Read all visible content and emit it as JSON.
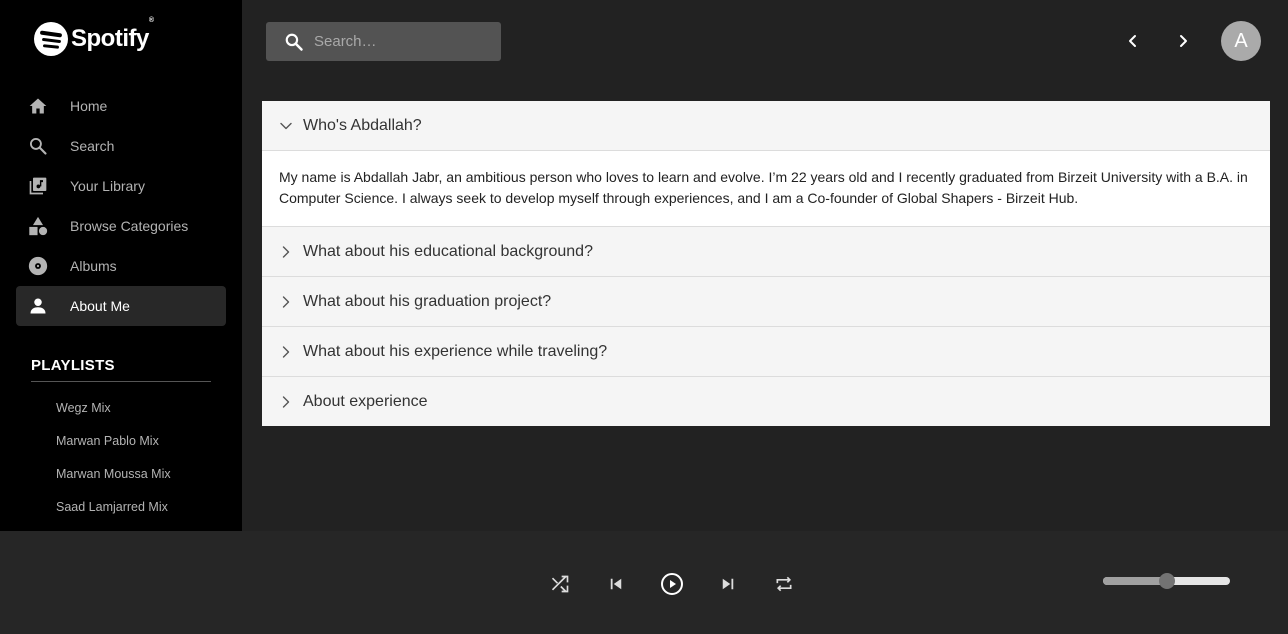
{
  "brand": {
    "name": "Spotify",
    "mark": "®"
  },
  "sidebar": {
    "items": [
      {
        "label": "Home",
        "icon": "home-icon"
      },
      {
        "label": "Search",
        "icon": "search-icon"
      },
      {
        "label": "Your Library",
        "icon": "library-icon"
      },
      {
        "label": "Browse Categories",
        "icon": "categories-icon"
      },
      {
        "label": "Albums",
        "icon": "album-icon"
      },
      {
        "label": "About Me",
        "icon": "person-icon",
        "active": true
      }
    ],
    "playlists_title": "PLAYLISTS",
    "playlists": [
      "Wegz Mix",
      "Marwan Pablo Mix",
      "Marwan Moussa Mix",
      "Saad Lamjarred Mix"
    ]
  },
  "search": {
    "placeholder": "Search…"
  },
  "header": {
    "avatar_letter": "A"
  },
  "accordion": [
    {
      "title": "Who's Abdallah?",
      "expanded": true,
      "body": "My name is Abdallah Jabr, an ambitious person who loves to learn and evolve. I’m 22 years old and I recently graduated from Birzeit University with a B.A. in Computer Science. I always seek to develop myself through experiences, and I am a Co-founder of Global Shapers - Birzeit Hub."
    },
    {
      "title": "What about his educational background?",
      "expanded": false
    },
    {
      "title": "What about his graduation project?",
      "expanded": false
    },
    {
      "title": "What about his experience while traveling?",
      "expanded": false
    },
    {
      "title": "About experience",
      "expanded": false
    }
  ],
  "player": {
    "controls": [
      "shuffle-icon",
      "previous-icon",
      "play-icon",
      "next-icon",
      "repeat-icon"
    ],
    "volume": 0.5
  },
  "colors": {
    "sidebar": "#000000",
    "main": "#222222",
    "player": "#262626",
    "active_nav": "#282828"
  }
}
